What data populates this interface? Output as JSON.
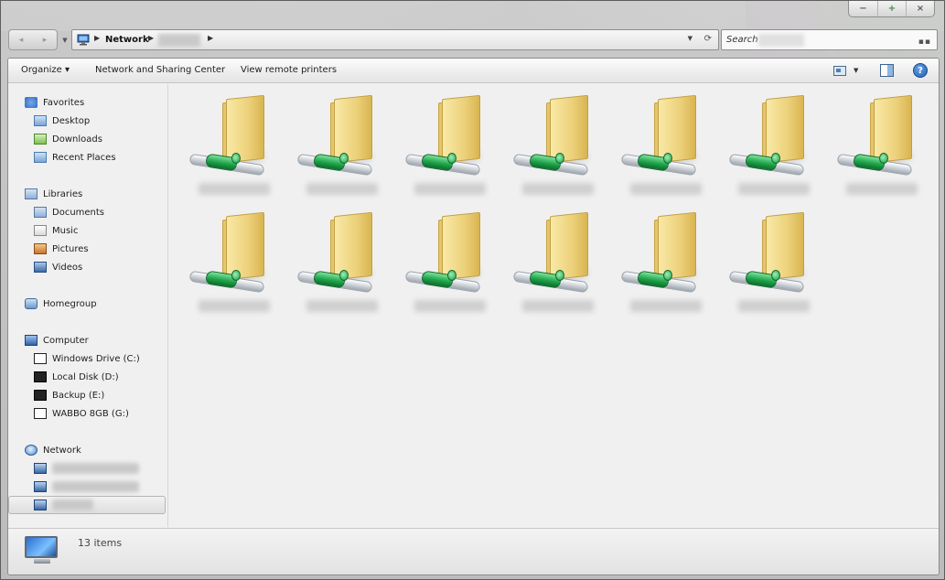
{
  "window": {
    "caption": {
      "minimize": "−",
      "maximize": "+",
      "close": "×"
    }
  },
  "nav": {
    "back_icon": "back-arrow-icon",
    "forward_icon": "forward-arrow-icon",
    "address": {
      "crumbs": [
        "Network"
      ],
      "network_icon": "network-icon"
    },
    "search": {
      "placeholder": "Search"
    }
  },
  "toolbar": {
    "organize": "Organize ▾",
    "sharing": "Network and Sharing Center",
    "printers": "View remote printers"
  },
  "sidebar": {
    "favorites": {
      "label": "Favorites",
      "items": [
        "Desktop",
        "Downloads",
        "Recent Places"
      ]
    },
    "libraries": {
      "label": "Libraries",
      "items": [
        "Documents",
        "Music",
        "Pictures",
        "Videos"
      ]
    },
    "homegroup": {
      "label": "Homegroup"
    },
    "computer": {
      "label": "Computer",
      "items": [
        "Windows Drive (C:)",
        "Local Disk (D:)",
        "Backup (E:)",
        "WABBO 8GB (G:)"
      ]
    },
    "network": {
      "label": "Network"
    }
  },
  "content": {
    "item_icon": "network-share-folder-icon",
    "item_count": 13
  },
  "details": {
    "count_text": "13 items",
    "icon": "network-monitor-icon"
  }
}
